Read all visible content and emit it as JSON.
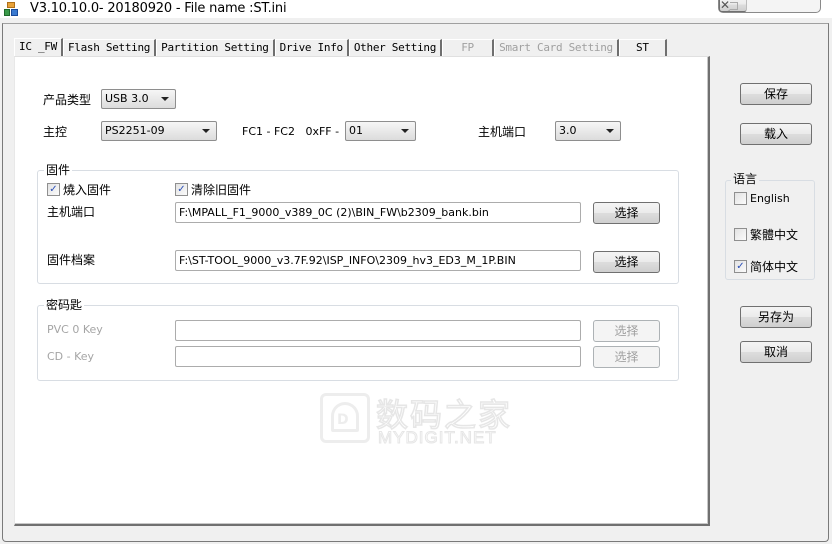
{
  "window": {
    "title": "V3.10.10.0- 20180920 - File name :ST.ini",
    "app_icon": "mpall-app-icon",
    "controls": {
      "minimize_icon": "minimize-icon",
      "maximize_icon": "maximize-icon",
      "close_icon": "close-icon",
      "close_glyph": "✕"
    }
  },
  "tabs": [
    {
      "label": "IC _FW",
      "state": "active"
    },
    {
      "label": "Flash Setting",
      "state": "normal"
    },
    {
      "label": "Partition Setting",
      "state": "normal"
    },
    {
      "label": "Drive Info",
      "state": "normal"
    },
    {
      "label": "Other Setting",
      "state": "normal"
    },
    {
      "label": "FP",
      "state": "disabled"
    },
    {
      "label": "Smart Card Setting",
      "state": "disabled"
    },
    {
      "label": "ST",
      "state": "normal"
    }
  ],
  "ic_fw": {
    "product_type": {
      "label": "产品类型",
      "value": "USB 3.0"
    },
    "controller": {
      "label": "主控",
      "value": "PS2251-09"
    },
    "fc": {
      "label": "FC1 - FC2   0xFF -",
      "value": "01"
    },
    "host_port": {
      "label": "主机端口",
      "value": "3.0"
    },
    "firmware_group": {
      "title": "固件",
      "burn_firmware": {
        "label": "燒入固件",
        "checked": true
      },
      "clear_old_firmware": {
        "label": "清除旧固件",
        "checked": true
      },
      "host_port_path": {
        "label": "主机端口",
        "value": "F:\\MPALL_F1_9000_v389_0C (2)\\BIN_FW\\b2309_bank.bin",
        "button": "选择"
      },
      "firmware_file": {
        "label": "固件档案",
        "value": "F:\\ST-TOOL_9000_v3.7F.92\\ISP_INFO\\2309_hv3_ED3_M_1P.BIN",
        "button": "选择"
      }
    },
    "key_group": {
      "title": "密码匙",
      "pvc0_key": {
        "label": "PVC 0 Key",
        "value": "",
        "button": "选择",
        "enabled": false
      },
      "cd_key": {
        "label": "CD - Key",
        "value": "",
        "button": "选择",
        "enabled": false
      }
    }
  },
  "watermark": {
    "cn": "数码之家",
    "en": "MYDIGIT.NET",
    "logo_letter": "D"
  },
  "sidebar": {
    "save": "保存",
    "load": "载入",
    "language": {
      "title": "语言",
      "options": [
        {
          "label": "English",
          "checked": false
        },
        {
          "label": "繁體中文",
          "checked": false
        },
        {
          "label": "简体中文",
          "checked": true
        }
      ]
    },
    "save_as": "另存为",
    "cancel": "取消"
  },
  "checkmark": "✓"
}
